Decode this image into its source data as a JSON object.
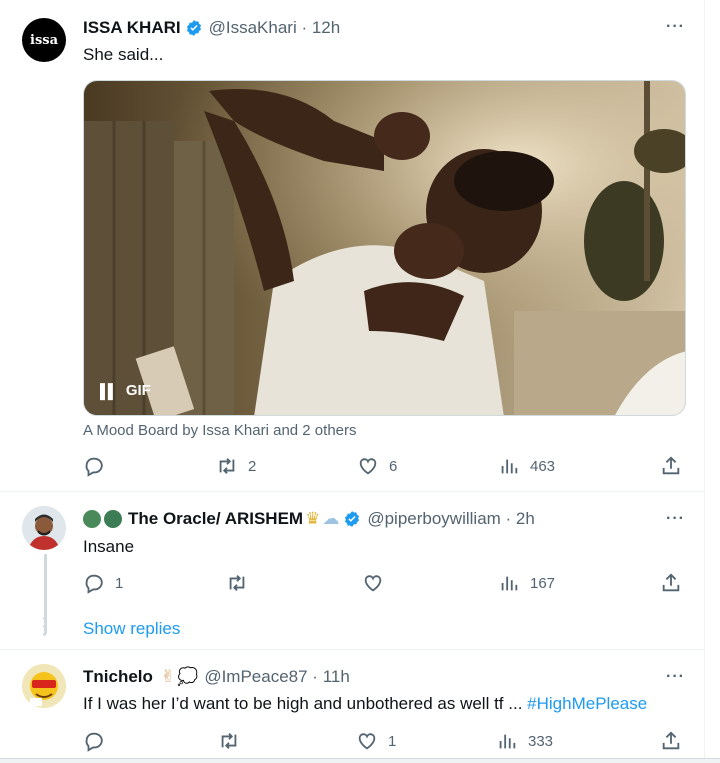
{
  "tweet1": {
    "name": "ISSA KHARI",
    "handle": "@IssaKhari · 12h",
    "text": "She said...",
    "avatar_text": "issa",
    "gif_label": "GIF",
    "mood_board": "A Mood Board by Issa Khari and 2 others",
    "replies": "",
    "retweets": "2",
    "likes": "6",
    "views": "463",
    "more": "···"
  },
  "tweet2": {
    "name": "The Oracle/ ARISHEM",
    "handle": "@piperboywilliam · 2h",
    "text": "Insane",
    "replies": "1",
    "retweets": "",
    "likes": "",
    "views": "167",
    "more": "···"
  },
  "show_replies": "Show replies",
  "tweet3": {
    "name": "Tnichelo",
    "handle": "@ImPeace87 · 11h",
    "text": "If I was her I’d want to be high and unbothered as well tf ...",
    "hashtag": "#HighMePlease",
    "replies": "",
    "retweets": "",
    "likes": "1",
    "views": "333",
    "more": "···"
  },
  "colors": {
    "accent": "#1d9bf0",
    "muted": "#536471",
    "verified": "#1d9bf0"
  }
}
